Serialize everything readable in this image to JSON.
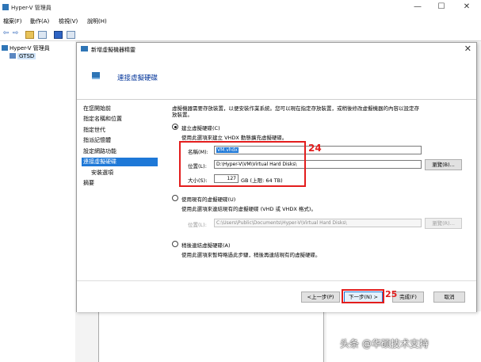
{
  "window": {
    "title": "Hyper-V 管理員",
    "min": "—",
    "max": "☐",
    "close": "✕"
  },
  "menu": [
    "檔案(F)",
    "動作(A)",
    "檢視(V)",
    "說明(H)"
  ],
  "toolbar": {
    "back": "⇦",
    "forward": "⇨"
  },
  "tree": {
    "root": "Hyper-V 管理員",
    "child": "GTSD"
  },
  "wizard": {
    "title": "新增虛擬機器精靈",
    "close": "✕",
    "header": "連接虛擬硬碟",
    "nav": [
      "在您開始前",
      "指定名稱和位置",
      "指定世代",
      "指派記憶體",
      "設定網路功能",
      "連接虛擬硬碟",
      "安裝選項",
      "摘要"
    ],
    "description_line1": "虛擬機器需要存放裝置，以便安裝作業系統。您可以現在指定存放裝置，或稍後修改虛擬機器的內容以設定存",
    "description_line2": "放裝置。",
    "create_option": "建立虛擬硬碟(C)",
    "create_desc": "使用此選項來建立 VHDX 動態擴充虛擬硬碟。",
    "name_label": "名稱(M):",
    "name_value": "VM.vhdx",
    "location_label": "位置(L):",
    "location_value": "D:\\Hyper-V\\VM\\Virtual Hard Disks\\",
    "browse1": "瀏覽(B)...",
    "size_label": "大小(S):",
    "size_value": "127",
    "size_unit": "GB (上限: 64 TB)",
    "existing_option": "使用現有的虛擬硬碟(U)",
    "existing_desc": "使用此選項來連結現有的虛擬硬碟 (VHD 或 VHDX 格式)。",
    "existing_location_label": "位置(L):",
    "existing_location_value": "C:\\Users\\Public\\Documents\\Hyper-V\\Virtual Hard Disks\\",
    "browse2": "瀏覽(R)...",
    "later_option": "稍後連結虛擬硬碟(A)",
    "later_desc": "使用此選項來暫時略過此步驟，稍後再連結現有的虛擬硬碟。",
    "prev_button": "<上一步(P)",
    "next_button": "下一步(N) >",
    "finish_button": "完成(F)",
    "cancel_button": "取消"
  },
  "annotations": {
    "step24": "24",
    "step25": "25",
    "color": "#e31d1d"
  },
  "watermark": "头条 @华硕技术支持",
  "colors": {
    "accent": "#1e78d7",
    "header_text": "#003399"
  }
}
